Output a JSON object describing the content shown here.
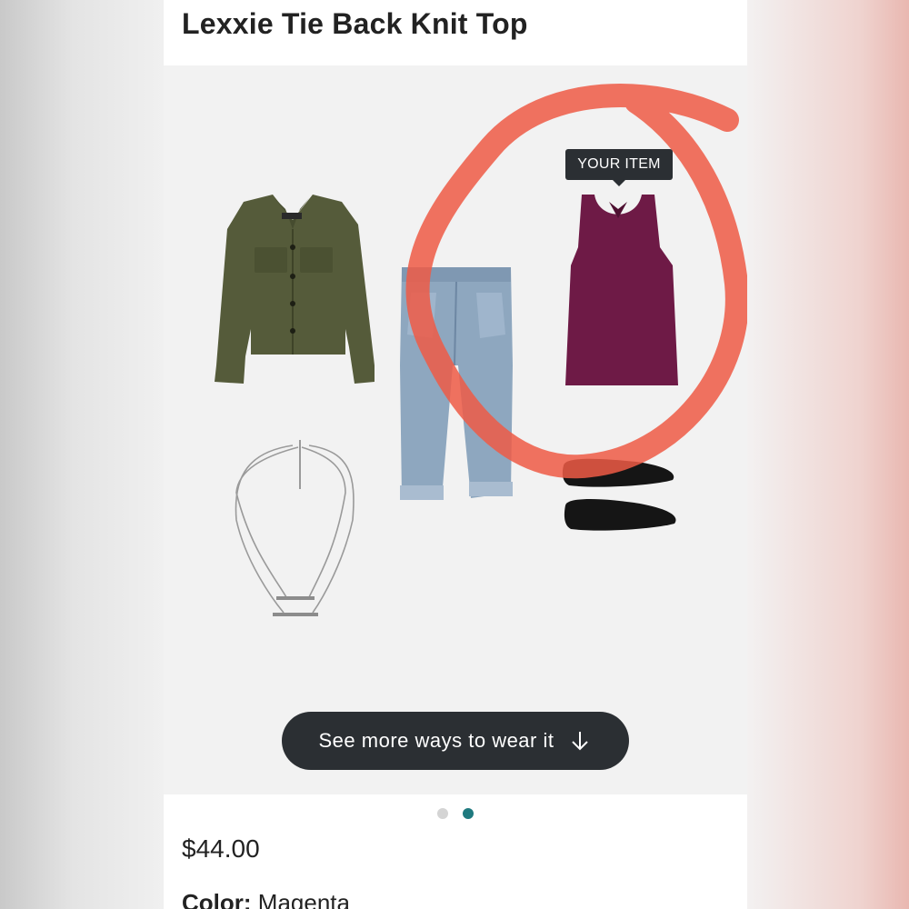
{
  "product": {
    "title": "Lexxie Tie Back Knit Top",
    "price": "$44.00",
    "color_label": "Color:",
    "color_value": "Magenta"
  },
  "outfit": {
    "badge": "YOUR ITEM",
    "items": [
      "olive-denim-jacket",
      "silver-layered-necklace",
      "light-wash-cropped-jeans",
      "magenta-tie-back-tank",
      "black-pointed-flats"
    ],
    "cta_label": "See more ways to wear it",
    "cta_icon": "arrow-down-icon"
  },
  "carousel": {
    "total_pages": 2,
    "active_page": 2,
    "active_color": "#1f7a7f"
  },
  "colors": {
    "annotation": "#ee5a45",
    "button": "#2b2f33",
    "top": "#6e1a46"
  }
}
